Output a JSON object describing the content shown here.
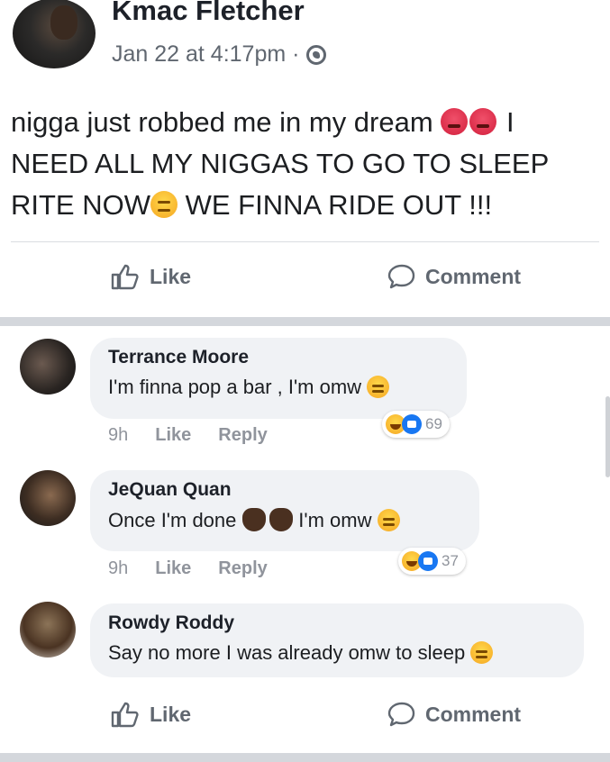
{
  "post": {
    "author": "Kmac Fletcher",
    "timestamp": "Jan 22 at 4:17pm ·",
    "privacy_icon": "globe-icon",
    "text_line1": "nigga just robbed me in my dream",
    "text_line1_tail": "I",
    "text_line2": "NEED ALL MY NIGGAS TO GO TO SLEEP",
    "text_line3_a": "RITE NOW",
    "text_line3_b": " WE FINNA RIDE OUT !!!"
  },
  "actions": {
    "like_label": "Like",
    "comment_label": "Comment"
  },
  "comments": [
    {
      "name": "Terrance Moore",
      "text": "I'm finna pop a bar , I'm omw",
      "time": "9h",
      "like": "Like",
      "reply": "Reply",
      "reaction_count": "69"
    },
    {
      "name": "JeQuan Quan",
      "text_a": "Once I'm done",
      "text_b": "I'm omw",
      "time": "9h",
      "like": "Like",
      "reply": "Reply",
      "reaction_count": "37"
    },
    {
      "name": "Rowdy Roddy",
      "text": "Say no more I was already omw to sleep"
    }
  ],
  "colors": {
    "meta_grey": "#606770",
    "bubble_bg": "#f0f2f5",
    "like_blue": "#1877f2"
  }
}
